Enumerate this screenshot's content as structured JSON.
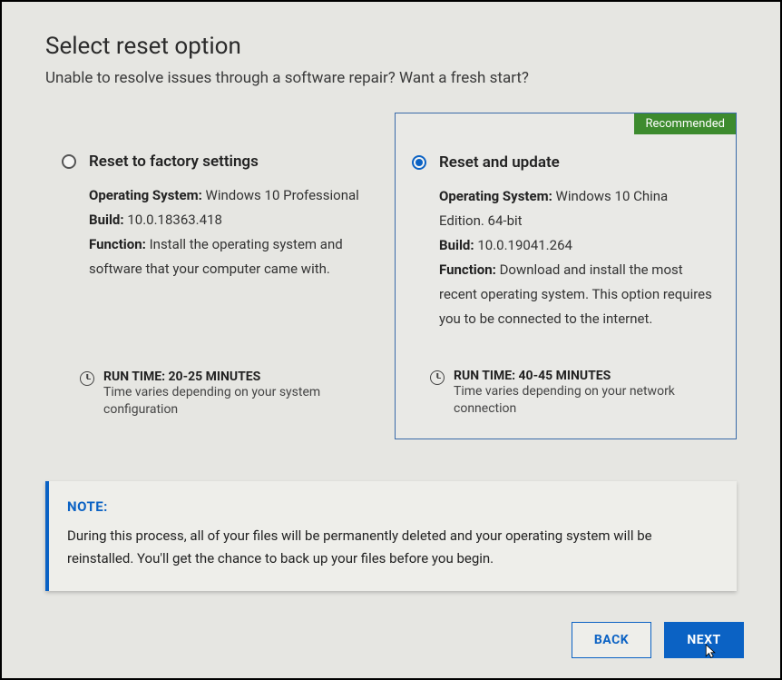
{
  "header": {
    "title": "Select reset option",
    "subtitle": "Unable to resolve issues through a software repair? Want a fresh start?"
  },
  "options": {
    "factory": {
      "title": "Reset to factory settings",
      "os_label": "Operating System:",
      "os_value": "Windows 10 Professional",
      "build_label": "Build:",
      "build_value": "10.0.18363.418",
      "function_label": "Function:",
      "function_value": "Install the operating system and software that your computer came with.",
      "runtime_title": "RUN TIME: 20-25 MINUTES",
      "runtime_sub": "Time varies depending on your system configuration"
    },
    "update": {
      "recommended_badge": "Recommended",
      "title": "Reset and update",
      "os_label": "Operating System:",
      "os_value": "Windows 10 China Edition. 64-bit",
      "build_label": "Build:",
      "build_value": "10.0.19041.264",
      "function_label": "Function:",
      "function_value": "Download and install the most recent operating system. This option requires you to be connected to the internet.",
      "runtime_title": "RUN TIME: 40-45 MINUTES",
      "runtime_sub": "Time varies depending on your network connection"
    }
  },
  "note": {
    "label": "NOTE:",
    "text": "During this process, all of your files will be permanently deleted and your operating system will be reinstalled. You'll get the chance to back up your files before you begin."
  },
  "footer": {
    "back_label": "BACK",
    "next_label": "NEXT"
  }
}
